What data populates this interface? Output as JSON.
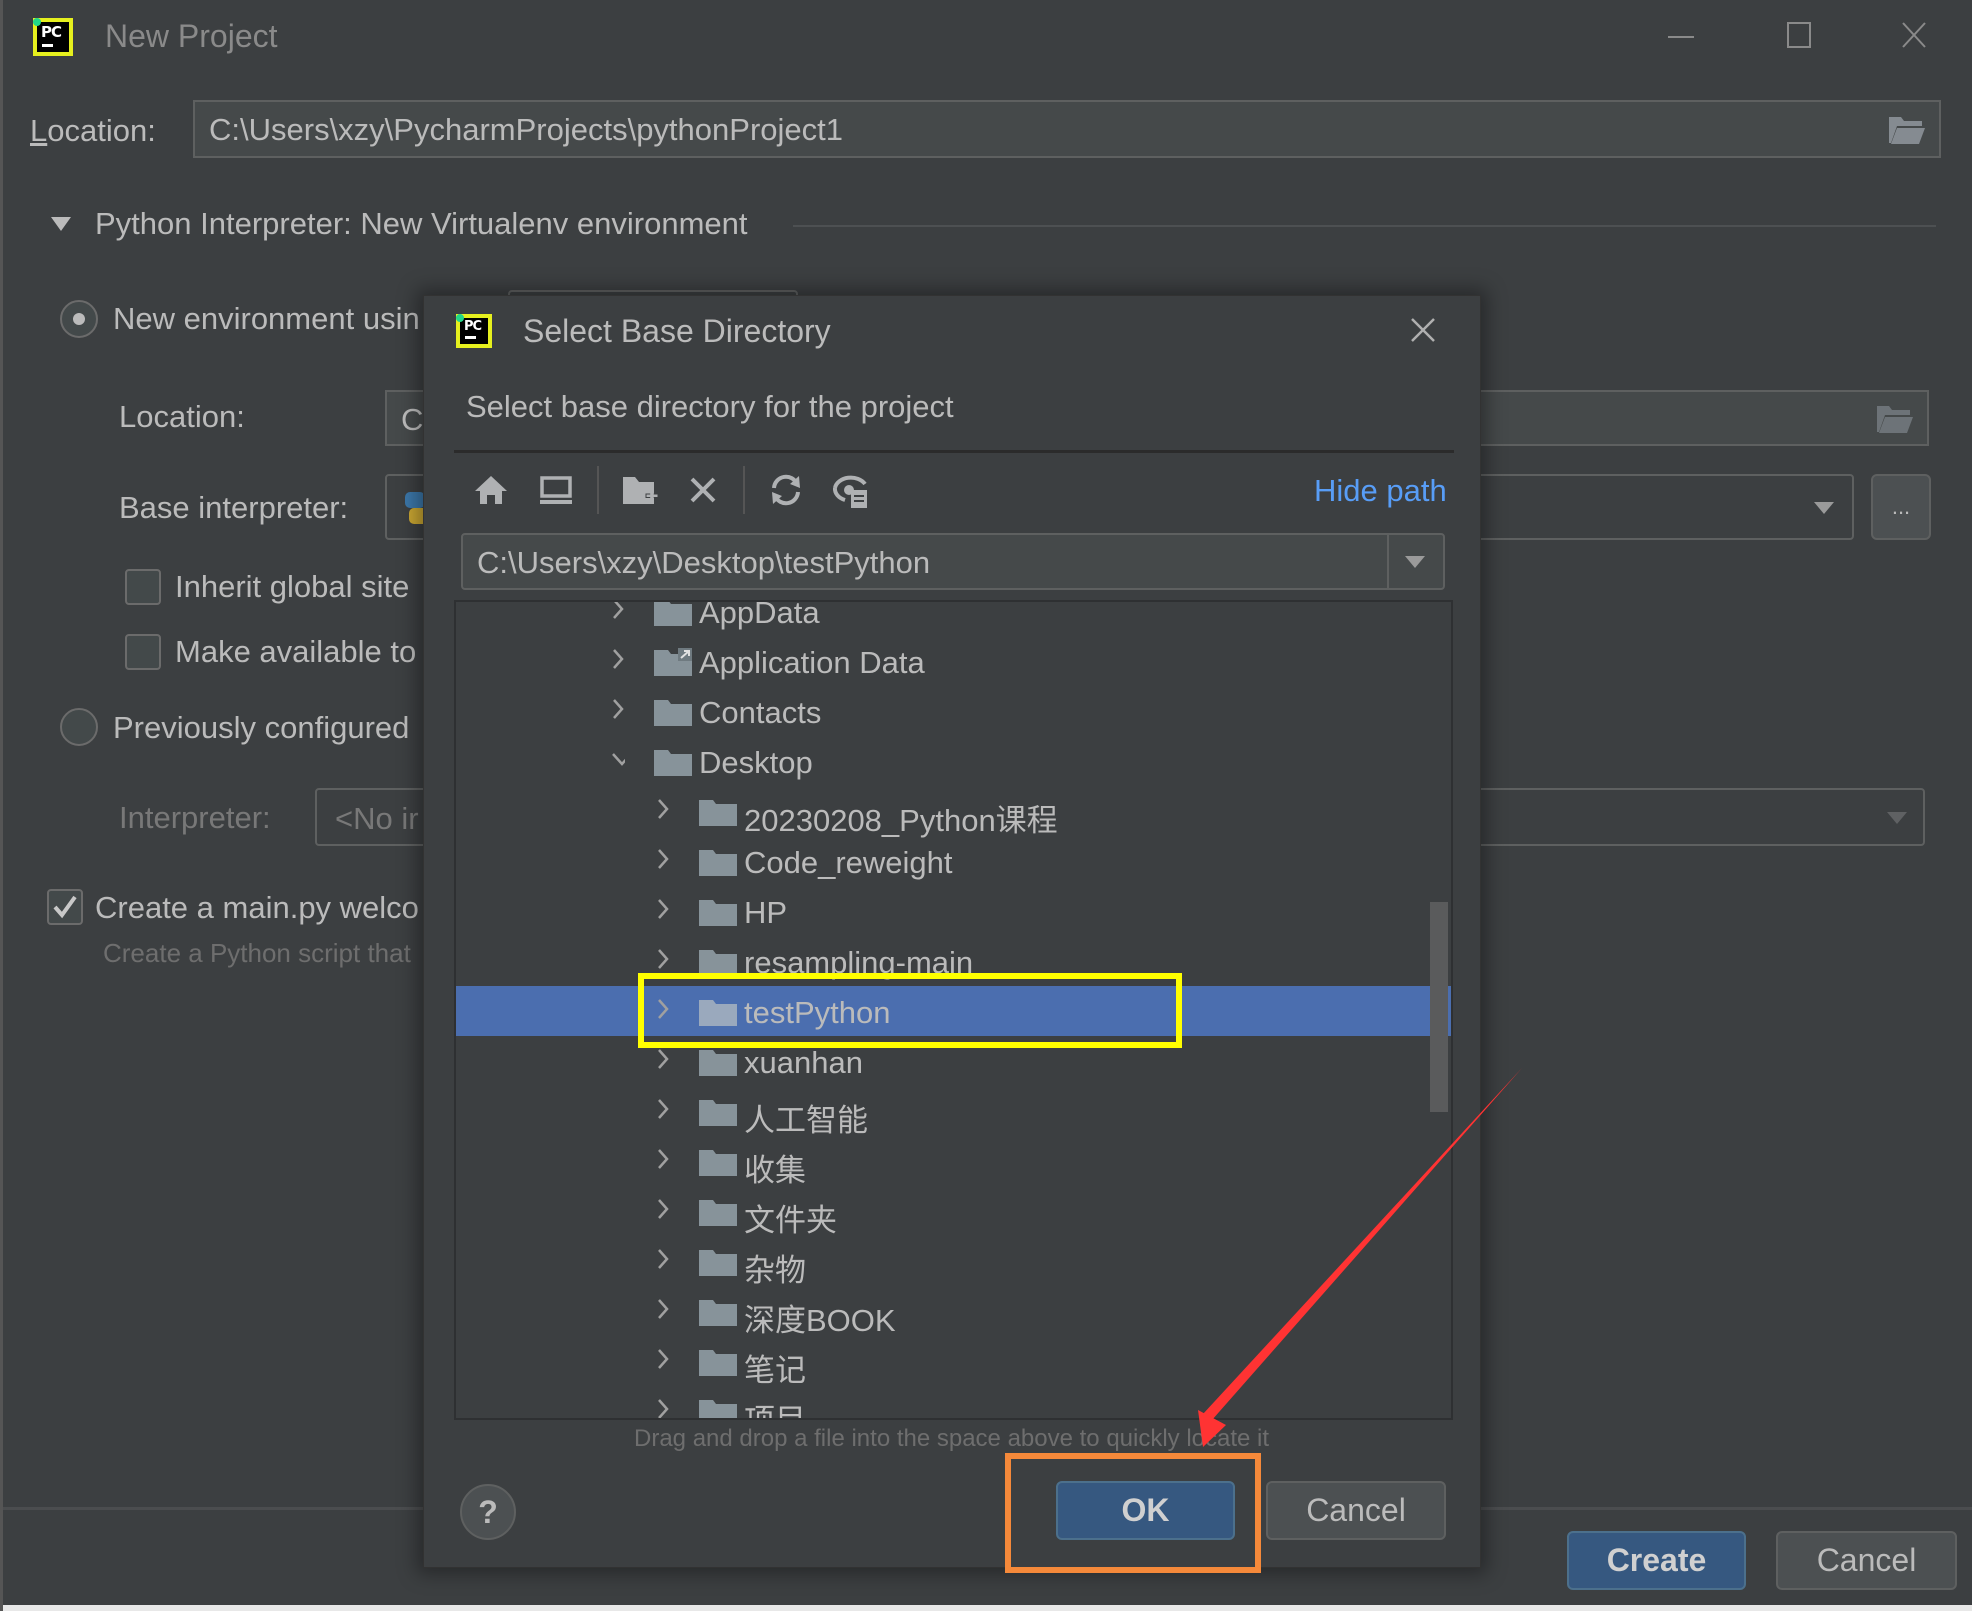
{
  "window": {
    "title": "New Project",
    "controls": [
      "minimize",
      "maximize",
      "close"
    ]
  },
  "main": {
    "location_label": "Location:",
    "location_value": "C:\\Users\\xzy\\PycharmProjects\\pythonProject1",
    "interpreter_section": "Python Interpreter: New Virtualenv environment",
    "new_env_label": "New environment usin",
    "env_location_label": "Location:",
    "env_location_value": "C:",
    "base_interpreter_label": "Base interpreter:",
    "inherit_label": "Inherit global site",
    "make_available_label": "Make available to",
    "previously_configured_label": "Previously configured",
    "interpreter_label": "Interpreter:",
    "interpreter_value": "<No ir",
    "create_main_label": "Create a main.py welco",
    "create_main_desc": "Create a Python script that",
    "create_main_checked": true,
    "new_env_selected": true,
    "browse_label": "...",
    "create_button": "Create",
    "cancel_button": "Cancel"
  },
  "dialog": {
    "title": "Select Base Directory",
    "subtitle": "Select base directory for the project",
    "toolbar": [
      {
        "icon": "home-icon",
        "tooltip": "Home"
      },
      {
        "icon": "desktop-icon",
        "tooltip": "Desktop"
      },
      {
        "icon": "new-folder-icon",
        "tooltip": "New Folder"
      },
      {
        "icon": "delete-icon",
        "tooltip": "Delete"
      },
      {
        "icon": "refresh-icon",
        "tooltip": "Refresh"
      },
      {
        "icon": "show-hidden-icon",
        "tooltip": "Show Hidden"
      }
    ],
    "hide_path_link": "Hide path",
    "path_value": "C:\\Users\\xzy\\Desktop\\testPython",
    "tree": [
      {
        "label": "AppData",
        "level": 0,
        "expanded": false,
        "selected": false,
        "shortcut": false
      },
      {
        "label": "Application Data",
        "level": 0,
        "expanded": false,
        "selected": false,
        "shortcut": true
      },
      {
        "label": "Contacts",
        "level": 0,
        "expanded": false,
        "selected": false,
        "shortcut": false
      },
      {
        "label": "Desktop",
        "level": 0,
        "expanded": true,
        "selected": false,
        "shortcut": false
      },
      {
        "label": "20230208_Python课程",
        "level": 1,
        "expanded": false,
        "selected": false,
        "shortcut": false
      },
      {
        "label": "Code_reweight",
        "level": 1,
        "expanded": false,
        "selected": false,
        "shortcut": false
      },
      {
        "label": "HP",
        "level": 1,
        "expanded": false,
        "selected": false,
        "shortcut": false
      },
      {
        "label": "resampling-main",
        "level": 1,
        "expanded": false,
        "selected": false,
        "shortcut": false
      },
      {
        "label": "testPython",
        "level": 1,
        "expanded": false,
        "selected": true,
        "shortcut": false
      },
      {
        "label": "xuanhan",
        "level": 1,
        "expanded": false,
        "selected": false,
        "shortcut": false
      },
      {
        "label": "人工智能",
        "level": 1,
        "expanded": false,
        "selected": false,
        "shortcut": false
      },
      {
        "label": "收集",
        "level": 1,
        "expanded": false,
        "selected": false,
        "shortcut": false
      },
      {
        "label": "文件夹",
        "level": 1,
        "expanded": false,
        "selected": false,
        "shortcut": false
      },
      {
        "label": "杂物",
        "level": 1,
        "expanded": false,
        "selected": false,
        "shortcut": false
      },
      {
        "label": "深度BOOK",
        "level": 1,
        "expanded": false,
        "selected": false,
        "shortcut": false
      },
      {
        "label": "笔记",
        "level": 1,
        "expanded": false,
        "selected": false,
        "shortcut": false
      },
      {
        "label": "项目",
        "level": 1,
        "expanded": false,
        "selected": false,
        "shortcut": false
      }
    ],
    "hint": "Drag and drop a file into the space above to quickly locate it",
    "help_label": "?",
    "ok_button": "OK",
    "cancel_button": "Cancel"
  },
  "annotations": {
    "highlight_color": "#ffff00",
    "ok_box_color": "#f5893a",
    "arrow_color": "#ff3333"
  },
  "colors": {
    "background": "#3c3f41",
    "selection": "#4b6eaf",
    "primary_button": "#365880",
    "link": "#589df6"
  }
}
